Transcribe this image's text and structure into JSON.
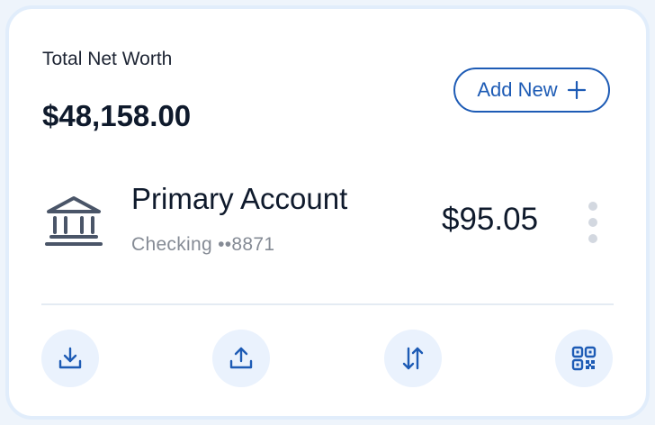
{
  "header": {
    "title": "Total Net Worth",
    "amount": "$48,158.00",
    "add_label": "Add New"
  },
  "account": {
    "icon": "bank-icon",
    "name": "Primary Account",
    "type": "Checking",
    "masked_number": "••8871",
    "balance": "$95.05"
  },
  "actions": [
    {
      "icon": "download-icon"
    },
    {
      "icon": "upload-icon"
    },
    {
      "icon": "transfer-icon"
    },
    {
      "icon": "qr-code-icon"
    }
  ],
  "colors": {
    "accent": "#1d5bb5",
    "action_bg": "#eaf2fd",
    "card_border": "#e1edfb",
    "text_primary": "#0f1a2c",
    "text_muted": "#858b95",
    "icon_gray": "#4a5568"
  }
}
